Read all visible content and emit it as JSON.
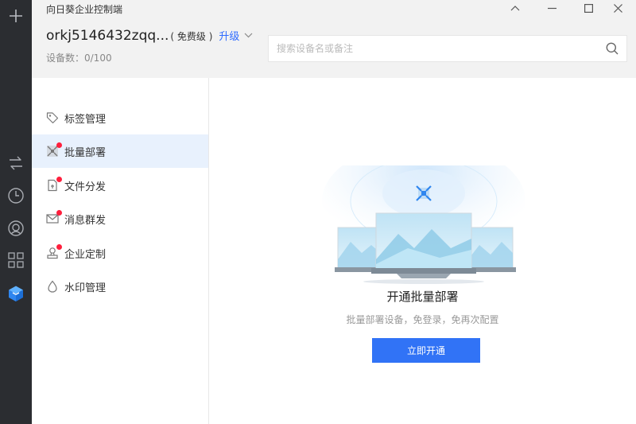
{
  "app": {
    "title": "向日葵企业控制端"
  },
  "account": {
    "name": "orkj5146432zqq...",
    "plan": "( 免费级 )",
    "upgrade_label": "升级",
    "device_count": "设备数：0/100"
  },
  "search": {
    "placeholder": "搜索设备名或备注"
  },
  "sidebar": {
    "items": [
      {
        "label": "标签管理",
        "badge": false
      },
      {
        "label": "批量部署",
        "badge": true,
        "active": true
      },
      {
        "label": "文件分发",
        "badge": true
      },
      {
        "label": "消息群发",
        "badge": true
      },
      {
        "label": "企业定制",
        "badge": true
      },
      {
        "label": "水印管理",
        "badge": false
      }
    ]
  },
  "main": {
    "feature_title": "开通批量部署",
    "feature_subtitle": "批量部署设备，免登录，免再次配置",
    "cta_label": "立即开通"
  },
  "colors": {
    "accent": "#3173f6",
    "rail": "#2b2d31",
    "active_item_bg": "#e8f1fd",
    "badge": "#ff1f3d",
    "header_bg": "#f2f2f2"
  },
  "icons": {
    "rail": [
      "plus-icon",
      "switch-arrows-icon",
      "clock-icon",
      "remote-person-icon",
      "app-grid-icon",
      "enterprise-cube-icon"
    ],
    "sidebar": [
      "tag-icon",
      "deploy-icon",
      "file-icon",
      "message-icon",
      "stamp-icon",
      "drop-icon"
    ]
  }
}
